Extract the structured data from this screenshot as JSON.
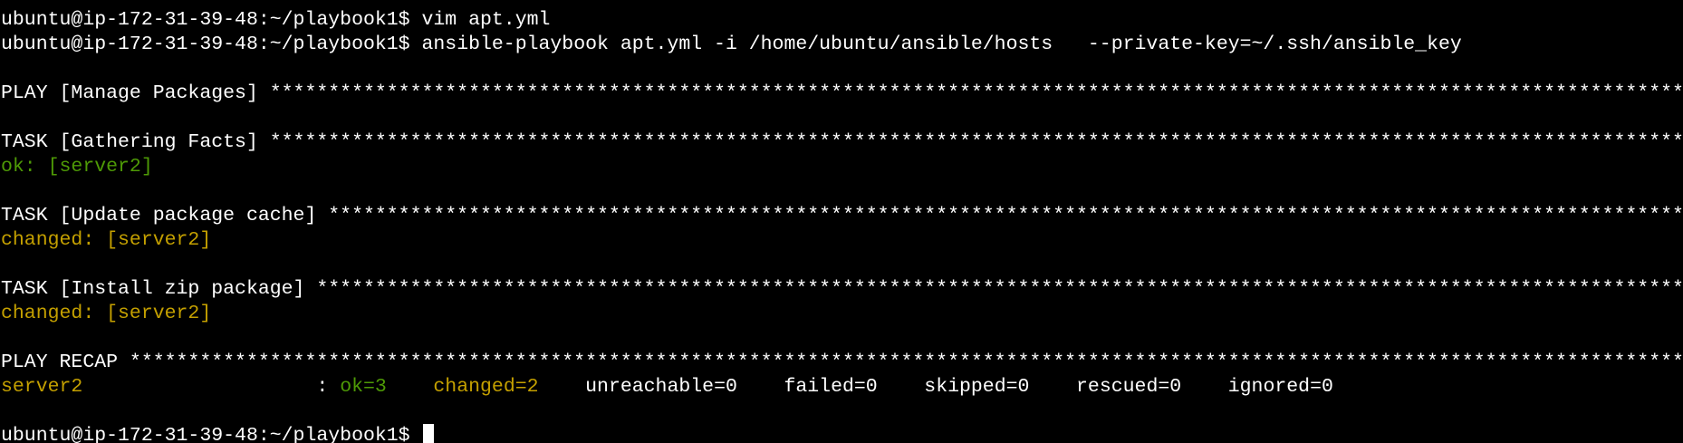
{
  "colors": {
    "background": "#000000",
    "text": "#ffffff",
    "ok": "#4e9a06",
    "changed": "#c4a000"
  },
  "terminal": {
    "prompt": "ubuntu@ip-172-31-39-48:~/playbook1$ ",
    "cmd1": "vim apt.yml",
    "cmd2": "ansible-playbook apt.yml -i /home/ubuntu/ansible/hosts   --private-key=~/.ssh/ansible_key",
    "play_header": "PLAY [Manage Packages] *****************************************************************************************************************************************************************************************",
    "task1_header": "TASK [Gathering Facts] *****************************************************************************************************************************************************************************************",
    "task1_result": "ok: [server2]",
    "task2_header": "TASK [Update package cache] ************************************************************************************************************************************************************************************",
    "task2_result": "changed: [server2]",
    "task3_header": "TASK [Install zip package] *************************************************************************************************************************************************************************************",
    "task3_result": "changed: [server2]",
    "recap_header": "PLAY RECAP *****************************************************************************************************************************************************************************************************",
    "recap": {
      "host": "server2",
      "sep": "                    : ",
      "ok": "ok=3",
      "gap1": "    ",
      "changed": "changed=2",
      "rest": "    unreachable=0    failed=0    skipped=0    rescued=0    ignored=0"
    },
    "final_prompt": "ubuntu@ip-172-31-39-48:~/playbook1$ "
  }
}
